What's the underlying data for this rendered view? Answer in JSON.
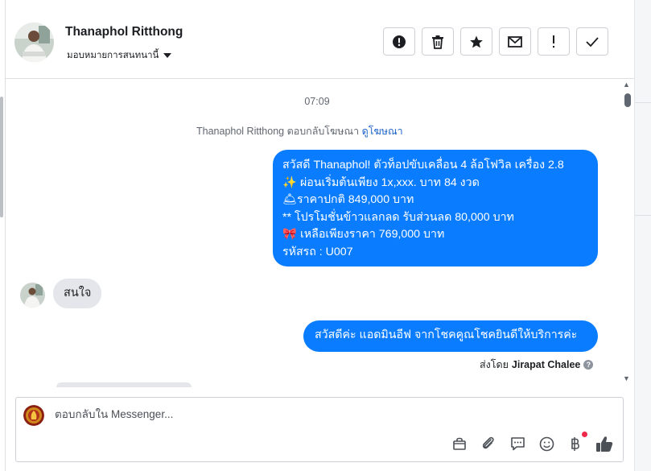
{
  "header": {
    "contact_name": "Thanaphol Ritthong",
    "assign_label": "มอบหมายการสนทนานี้",
    "actions": [
      {
        "name": "spam-button",
        "icon": "exclamation-circle-icon"
      },
      {
        "name": "delete-button",
        "icon": "trash-icon"
      },
      {
        "name": "star-button",
        "icon": "star-icon"
      },
      {
        "name": "mark-unread-button",
        "icon": "envelope-icon"
      },
      {
        "name": "follow-up-button",
        "icon": "exclamation-icon"
      },
      {
        "name": "mark-done-button",
        "icon": "checkmark-icon"
      }
    ]
  },
  "thread": {
    "timestamp": "07:09",
    "ad_reply_text": "Thanaphol Ritthong ตอบกลับโฆษณา",
    "ad_link": "ดูโฆษณา",
    "outgoing_1": {
      "line1": "สวัสดี Thanaphol! ตัวท็อปขับเคลื่อน 4 ล้อโฟวิล เครื่อง 2.8",
      "line2_emoji": "✨",
      "line2": " ผ่อนเริ่มต้นเพียง 1x,xxx. บาท 84 งวด",
      "line3_emoji": "🛎",
      "line3": "ราคาปกติ 849,000 บาท",
      "line4": "** โปรโมชั่นข้าวแลกลด รับส่วนลด 80,000 บาท",
      "line5_emoji": "🎀",
      "line5": " เหลือเพียงราคา 769,000 บาท",
      "line6": " รหัสรถ : U007"
    },
    "incoming_1": "สนใจ",
    "outgoing_2": "สวัสดีค่ะ แอดมินอีฟ จากโชคคูณโชคยินดีให้บริการค่ะ",
    "sent_by_prefix": "ส่งโดย",
    "sent_by_name": "Jirapat Chalee"
  },
  "composer": {
    "placeholder": "ตอบกลับใน Messenger...",
    "tools": [
      "shopping-bag-icon",
      "paperclip-icon",
      "saved-replies-icon",
      "emoji-icon",
      "baht-payment-icon",
      "thumbs-up-icon"
    ]
  },
  "colors": {
    "accent_bubble": "#0a7cff",
    "incoming_bubble": "#e4e6eb",
    "link": "#1d63c7"
  }
}
